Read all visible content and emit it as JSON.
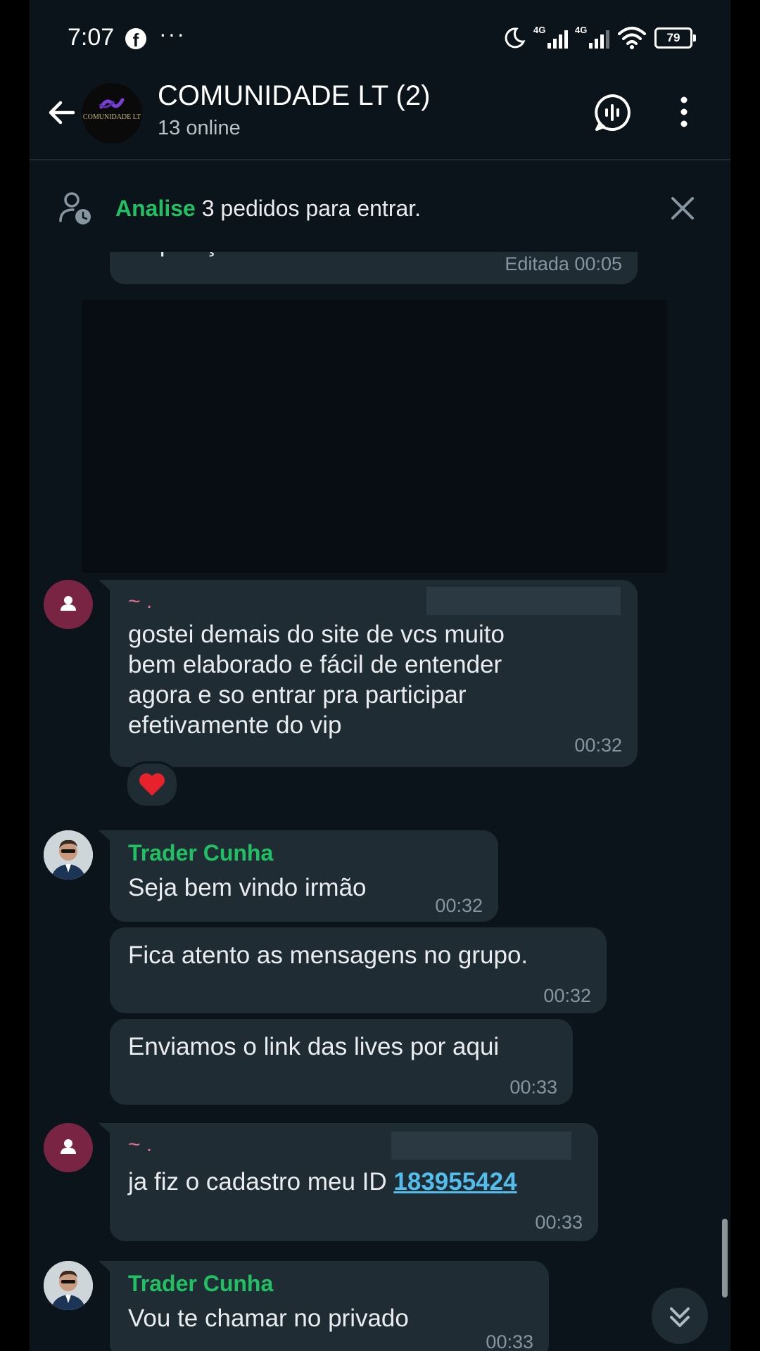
{
  "status_bar": {
    "time": "7:07",
    "notification_icon": "facebook-icon",
    "overflow": "···",
    "signal1_label": "4G",
    "signal2_label": "4G",
    "battery": "79"
  },
  "header": {
    "title": "COMUNIDADE LT (2)",
    "subtitle": "13 online",
    "logo_text": "COMUNIDADE LT"
  },
  "banner": {
    "accent": "Analise",
    "text": " 3 pedidos para entrar."
  },
  "messages": [
    {
      "id": "m0",
      "text": "disposição.",
      "time": "Editada 00:05"
    },
    {
      "id": "m1",
      "sender": "~ .",
      "text": [
        "gostei demais do site de vcs muito",
        "bem elaborado e fácil de entender",
        "agora e so entrar pra participar",
        "efetivamente do vip"
      ],
      "time": "00:32",
      "reaction": "❤️"
    },
    {
      "id": "m2",
      "sender": "Trader Cunha",
      "text": "Seja bem vindo irmão",
      "time": "00:32"
    },
    {
      "id": "m3",
      "text": "Fica atento as mensagens no grupo.",
      "time": "00:32"
    },
    {
      "id": "m4",
      "text": "Enviamos o link das lives por aqui",
      "time": "00:33"
    },
    {
      "id": "m5",
      "sender": "~ .",
      "text": "ja fiz o cadastro meu ID ",
      "link": "183955424",
      "time": "00:33"
    },
    {
      "id": "m6",
      "sender": "Trader Cunha",
      "text": "Vou te chamar no privado",
      "time": "00:33"
    }
  ],
  "colors": {
    "accent": "#21c063",
    "bubble": "#1f2c34",
    "background": "#0b141b",
    "link": "#53bdeb"
  }
}
